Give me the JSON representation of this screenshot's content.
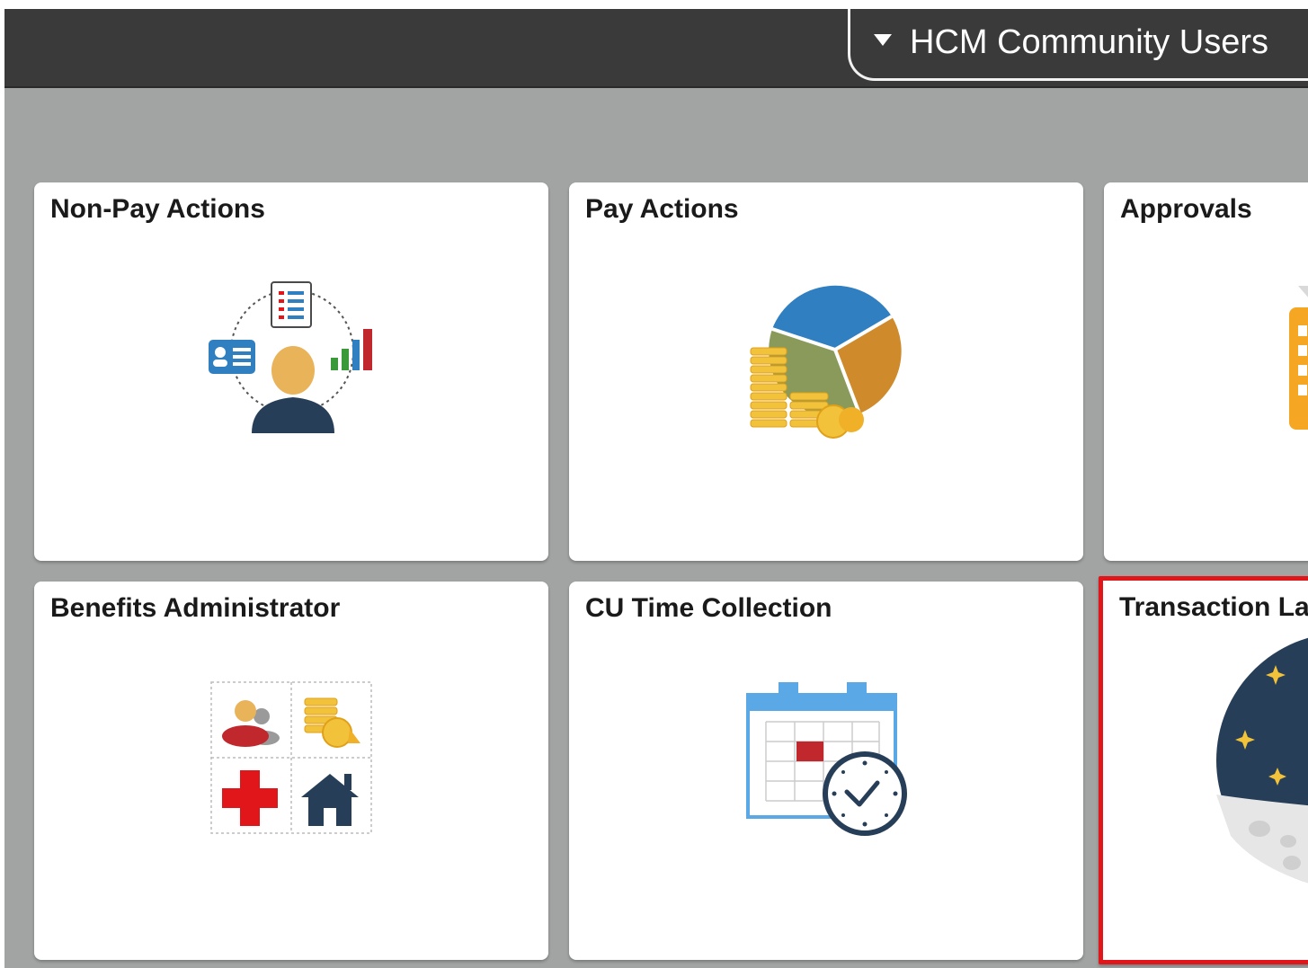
{
  "header": {
    "homepage_selector_label": "HCM Community Users"
  },
  "tiles": [
    {
      "title": "Non-Pay Actions",
      "icon": "employee-actions-icon"
    },
    {
      "title": "Pay Actions",
      "icon": "pie-chart-coins-icon"
    },
    {
      "title": "Approvals",
      "icon": "approvals-icon"
    },
    {
      "title": "Benefits Administrator",
      "icon": "benefits-grid-icon"
    },
    {
      "title": "CU Time Collection",
      "icon": "calendar-clock-icon"
    },
    {
      "title": "Transaction La",
      "icon": "night-sky-moon-icon"
    }
  ],
  "colors": {
    "topbar": "#3a3a3a",
    "page_background": "#a2a4a3",
    "tile_background": "#ffffff",
    "highlight_border": "#e0161b"
  }
}
